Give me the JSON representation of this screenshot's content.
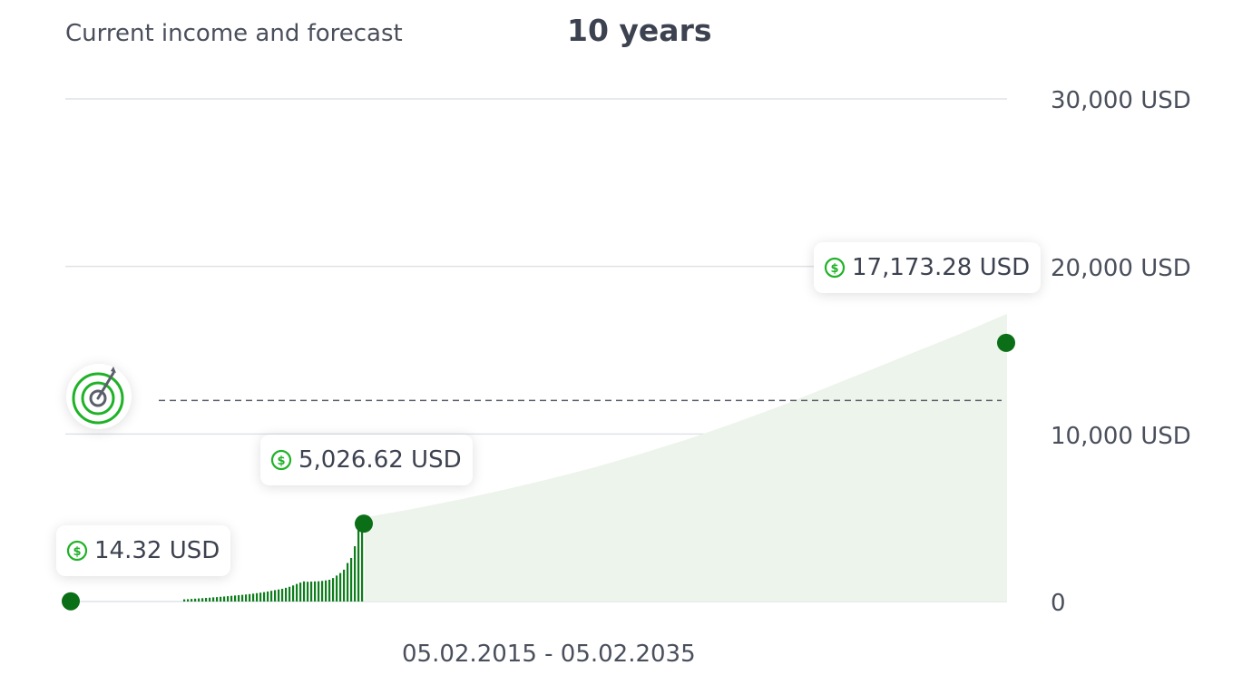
{
  "header": {
    "title": "Current income and forecast",
    "period": "10 years"
  },
  "date_range": "05.02.2015 - 05.02.2035",
  "colors": {
    "bar": "#0e7d1b",
    "dot": "#0b6f17",
    "forecast_fill": "#edf4eb",
    "grid": "#dfe2e8",
    "goal_line": "#5a5f6b",
    "icon_green": "#1fb227"
  },
  "icons": {
    "goal": "target-icon",
    "amount": "dollar-circle-icon"
  },
  "chart_data": {
    "type": "bar",
    "title": "",
    "ylim": [
      0,
      30000
    ],
    "y_tick_labels": [
      "0",
      "10,000 USD",
      "20,000 USD",
      "30,000 USD"
    ],
    "y_ticks": [
      0,
      10000,
      20000,
      30000
    ],
    "grid": true,
    "goal_value": 12000,
    "history_bars": [
      130,
      140,
      155,
      170,
      185,
      200,
      215,
      230,
      250,
      265,
      285,
      300,
      320,
      340,
      360,
      380,
      400,
      420,
      445,
      470,
      500,
      530,
      560,
      600,
      640,
      680,
      720,
      760,
      820,
      880,
      960,
      1050,
      1130,
      1200,
      1180,
      1190,
      1200,
      1210,
      1230,
      1260,
      1300,
      1400,
      1550,
      1700,
      1900,
      2300,
      2600,
      3300,
      4300,
      4650
    ],
    "forecast_curve": [
      5026.62,
      5500,
      6050,
      6650,
      7300,
      8000,
      8800,
      9650,
      10600,
      11600,
      12700,
      13800,
      14900,
      16000,
      17173.28
    ],
    "callouts": [
      {
        "label": "14.32 USD",
        "value": 14.32
      },
      {
        "label": "5,026.62 USD",
        "value": 5026.62
      },
      {
        "label": "17,173.28 USD",
        "value": 17173.28
      }
    ]
  }
}
